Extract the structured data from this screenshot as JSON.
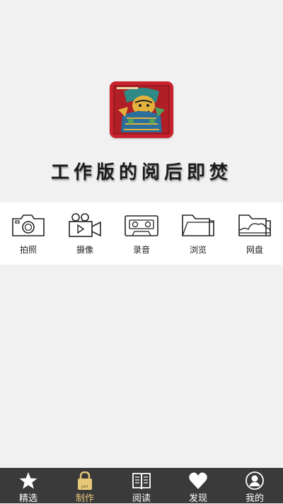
{
  "hero": {
    "slogan": "工作版的阅后即焚",
    "app_icon": "door-god-artwork-icon"
  },
  "tools": [
    {
      "label": "拍照",
      "icon": "camera-icon"
    },
    {
      "label": "摄像",
      "icon": "video-camera-icon"
    },
    {
      "label": "录音",
      "icon": "cassette-tape-icon"
    },
    {
      "label": "浏览",
      "icon": "folder-icon"
    },
    {
      "label": "网盘",
      "icon": "cloud-folder-icon"
    }
  ],
  "tabbar": {
    "active_index": 1,
    "active_color": "#e8c97a",
    "background": "#3a3a3a",
    "tabs": [
      {
        "label": "精选",
        "icon": "star-icon"
      },
      {
        "label": "制作",
        "icon": "lock-icon",
        "icon_text": "por"
      },
      {
        "label": "阅读",
        "icon": "open-book-icon"
      },
      {
        "label": "发现",
        "icon": "heart-icon"
      },
      {
        "label": "我的",
        "icon": "user-icon"
      }
    ]
  }
}
